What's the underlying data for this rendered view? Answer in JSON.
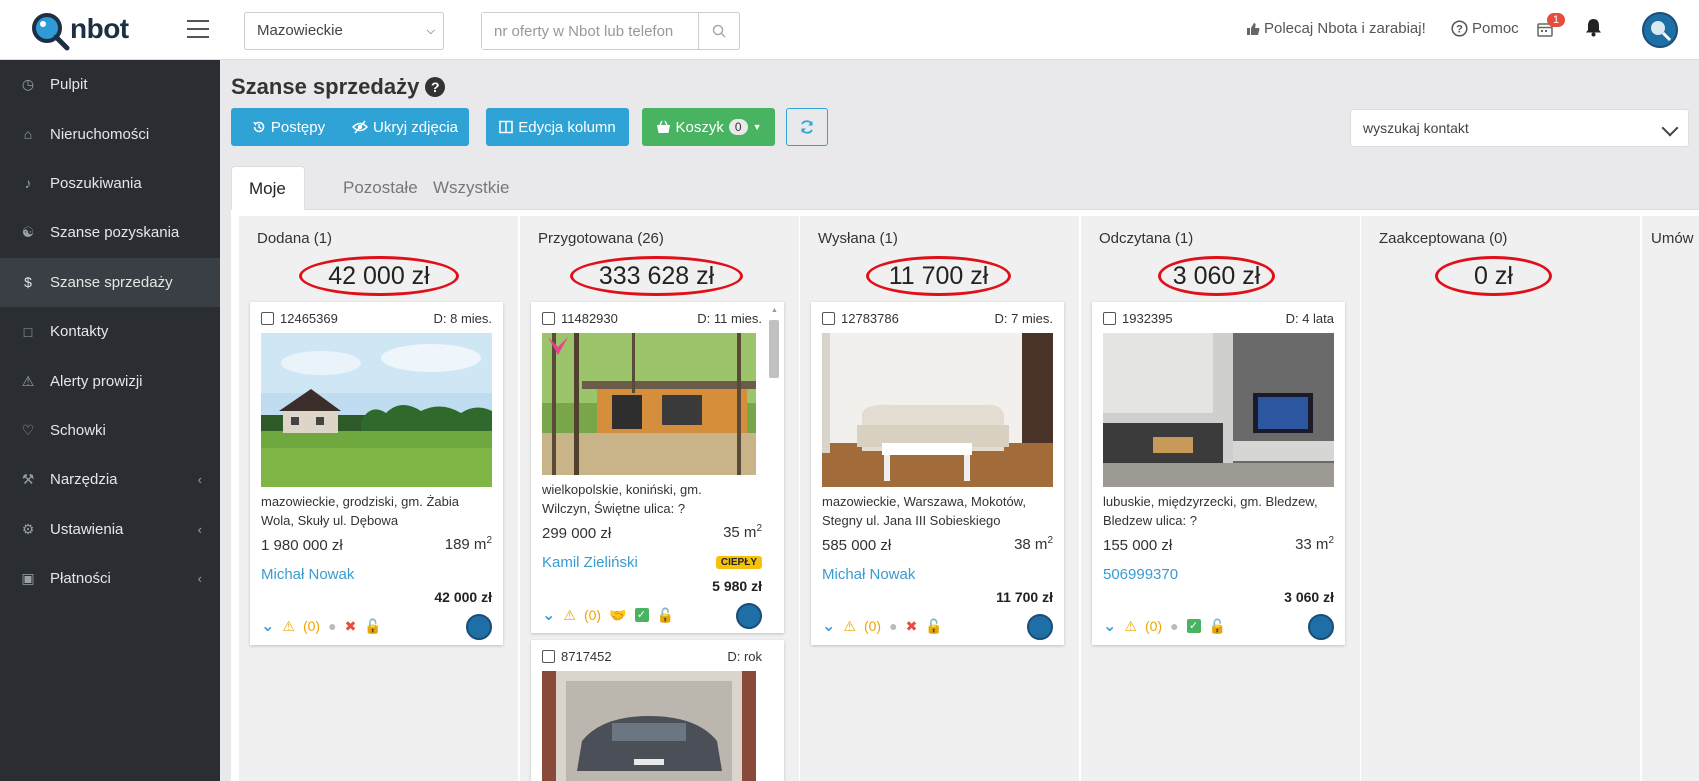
{
  "brand": {
    "name": "nbot"
  },
  "topbar": {
    "region_value": "Mazowieckie",
    "search_placeholder": "nr oferty w Nbot lub telefon",
    "recommend_label": "Polecaj Nbota i zarabiaj!",
    "help_label": "Pomoc",
    "calendar_badge": "1"
  },
  "sidebar": {
    "items": [
      {
        "label": "Pulpit",
        "icon": "gauge-icon",
        "chevron": false
      },
      {
        "label": "Nieruchomości",
        "icon": "home-icon",
        "chevron": false
      },
      {
        "label": "Poszukiwania",
        "icon": "bell-icon",
        "chevron": false
      },
      {
        "label": "Szanse pozyskania",
        "icon": "handshake-icon",
        "chevron": false
      },
      {
        "label": "Szanse sprzedaży",
        "icon": "dollar-icon",
        "chevron": false,
        "active": true
      },
      {
        "label": "Kontakty",
        "icon": "address-book-icon",
        "chevron": false
      },
      {
        "label": "Alerty prowizji",
        "icon": "warning-icon",
        "chevron": false
      },
      {
        "label": "Schowki",
        "icon": "heart-icon",
        "chevron": false
      },
      {
        "label": "Narzędzia",
        "icon": "wrench-icon",
        "chevron": true
      },
      {
        "label": "Ustawienia",
        "icon": "gear-icon",
        "chevron": true
      },
      {
        "label": "Płatności",
        "icon": "cart-icon",
        "chevron": true
      }
    ]
  },
  "page": {
    "title": "Szanse sprzedaży",
    "toolbar": {
      "progress_label": "Postępy",
      "hide_photos_label": "Ukryj zdjęcia",
      "edit_columns_label": "Edycja kolumn",
      "basket_label": "Koszyk",
      "basket_count": "0"
    },
    "contact_search_placeholder": "wyszukaj kontakt",
    "tabs": [
      {
        "label": "Moje",
        "active": true
      },
      {
        "label": "Pozostałe",
        "active": false
      },
      {
        "label": "Wszystkie",
        "active": false
      }
    ]
  },
  "columns": [
    {
      "title": "Dodana (1)",
      "amount": "42 000 zł",
      "cards": [
        {
          "id": "12465369",
          "duration": "D: 8 mies.",
          "location": "mazowieckie, grodziski, gm. Żabia Wola, Skuły ul. Dębowa",
          "price": "1 980 000 zł",
          "area": "189 m",
          "agent": "Michał Nowak",
          "commission": "42 000 zł",
          "warn_count": "(0)"
        }
      ]
    },
    {
      "title": "Przygotowana (26)",
      "amount": "333 628 zł",
      "cards": [
        {
          "id": "11482930",
          "duration": "D: 11 mies.",
          "location": "wielkopolskie, koniński, gm. Wilczyn, Świętne ulica: ?",
          "price": "299 000 zł",
          "area": "35 m",
          "agent": "Kamil Zieliński",
          "tag": "CIEPŁY",
          "commission": "5 980 zł",
          "warn_count": "(0)"
        },
        {
          "id": "8717452",
          "duration": "D: rok"
        }
      ]
    },
    {
      "title": "Wysłana (1)",
      "amount": "11 700 zł",
      "cards": [
        {
          "id": "12783786",
          "duration": "D: 7 mies.",
          "location": "mazowieckie, Warszawa, Mokotów, Stegny ul. Jana III Sobieskiego",
          "price": "585 000 zł",
          "area": "38 m",
          "agent": "Michał Nowak",
          "commission": "11 700 zł",
          "warn_count": "(0)"
        }
      ]
    },
    {
      "title": "Odczytana (1)",
      "amount": "3 060 zł",
      "cards": [
        {
          "id": "1932395",
          "duration": "D: 4 lata",
          "location": "lubuskie, międzyrzecki, gm. Bledzew, Bledzew ulica: ?",
          "price": "155 000 zł",
          "area": "33 m",
          "agent": "506999370",
          "commission": "3 060 zł",
          "warn_count": "(0)"
        }
      ]
    },
    {
      "title": "Zaakceptowana (0)",
      "amount": "0 zł",
      "cards": []
    },
    {
      "title": "Umów",
      "amount": "",
      "cards": []
    }
  ]
}
